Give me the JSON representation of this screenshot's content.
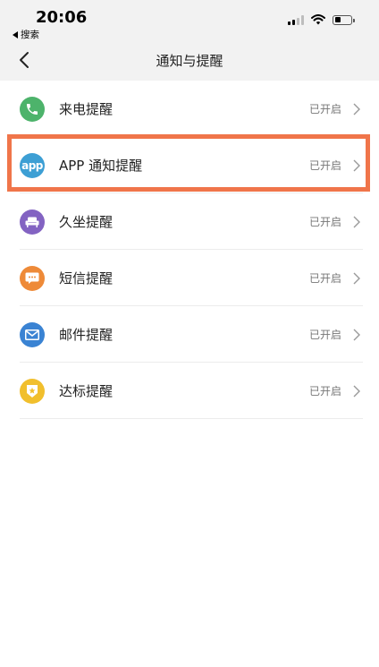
{
  "status_bar": {
    "time": "20:06",
    "back_app": "搜索"
  },
  "nav": {
    "title": "通知与提醒"
  },
  "items": [
    {
      "label": "来电提醒",
      "status": "已开启",
      "icon": "phone-icon",
      "color": "#4db36b"
    },
    {
      "label": "APP 通知提醒",
      "status": "已开启",
      "icon": "app-icon",
      "icon_text": "app",
      "color": "#3d9fd4"
    },
    {
      "label": "久坐提醒",
      "status": "已开启",
      "icon": "sofa-icon",
      "color": "#8363c2"
    },
    {
      "label": "短信提醒",
      "status": "已开启",
      "icon": "message-icon",
      "color": "#ee8a38"
    },
    {
      "label": "邮件提醒",
      "status": "已开启",
      "icon": "mail-icon",
      "color": "#3a83d3"
    },
    {
      "label": "达标提醒",
      "status": "已开启",
      "icon": "badge-icon",
      "color": "#f1bf2d"
    }
  ],
  "highlight_color": "#f0754a"
}
